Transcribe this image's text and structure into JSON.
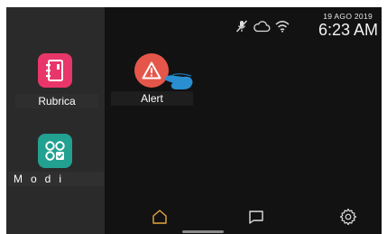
{
  "status": {
    "date": "19 AGO 2019",
    "time": "6:23 AM",
    "icons": [
      "mute-mic-icon",
      "cloud-icon",
      "wifi-icon"
    ]
  },
  "sidebar": {
    "apps": [
      {
        "label": "Rubrica",
        "icon": "contacts-book-icon",
        "color": "#e8366b"
      },
      {
        "label": "Modi",
        "icon": "modes-grid-icon",
        "color": "#22a090"
      }
    ]
  },
  "home": {
    "apps": [
      {
        "label": "Alert",
        "icon": "warning-icon",
        "color": "#e5564a"
      }
    ]
  },
  "bottom_nav": {
    "items": [
      "home-icon",
      "chat-icon",
      "settings-icon"
    ],
    "accent": "#e6a640"
  }
}
